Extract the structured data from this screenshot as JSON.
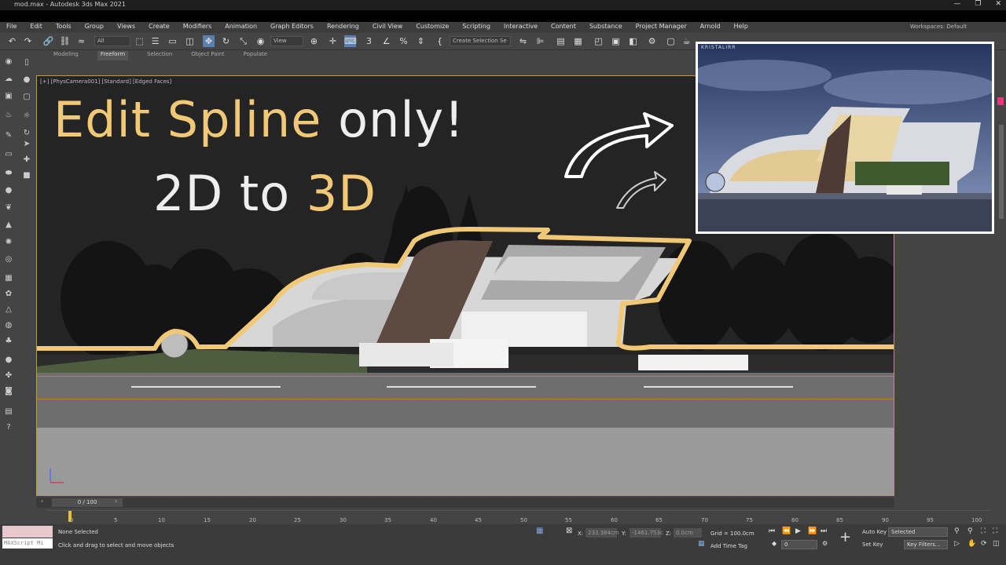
{
  "window": {
    "title": "mod.max - Autodesk 3ds Max 2021",
    "controls": [
      "—",
      "❐",
      "✕"
    ]
  },
  "menu": {
    "items": [
      "File",
      "Edit",
      "Tools",
      "Group",
      "Views",
      "Create",
      "Modifiers",
      "Animation",
      "Graph Editors",
      "Rendering",
      "Civil View",
      "Customize",
      "Scripting",
      "Interactive",
      "Content",
      "Substance",
      "Project Manager",
      "Arnold",
      "Help"
    ],
    "workspace_label": "Workspaces:",
    "workspace_value": "Default"
  },
  "toolbar": {
    "filter_value": "All",
    "view_value": "View",
    "selection_set_placeholder": "Create Selection Se"
  },
  "ribbon": {
    "tabs": [
      "Modeling",
      "Freeform",
      "Selection",
      "Object Paint",
      "Populate"
    ],
    "active": "Freeform"
  },
  "viewport": {
    "label": "[+] [PhysCamera001] [Standard] [Edged Faces]"
  },
  "overlay": {
    "line1_a": "Edit Spline",
    "line1_b": "only!",
    "line2_a": "2D to",
    "line2_b": "3D",
    "photo_watermark": "KRISTALIRR"
  },
  "timeline": {
    "frame": "0 / 100",
    "ticks": [
      "0",
      "5",
      "10",
      "15",
      "20",
      "25",
      "30",
      "35",
      "40",
      "45",
      "50",
      "55",
      "60",
      "65",
      "70",
      "75",
      "80",
      "85",
      "90",
      "95",
      "100"
    ]
  },
  "status": {
    "maxscript": "MAXScript Mi",
    "selection": "None Selected",
    "prompt": "Click and drag to select and move objects",
    "x_label": "X:",
    "x_value": "233.384cm",
    "y_label": "Y:",
    "y_value": "-1461.753c",
    "z_label": "Z:",
    "z_value": "0.0cm",
    "grid": "Grid = 100.0cm",
    "add_time_tag": "Add Time Tag",
    "frame_value": "0",
    "auto_key": "Auto Key",
    "set_key": "Set Key",
    "key_mode": "Selected",
    "key_filters": "Key Filters..."
  },
  "colors": {
    "accent_yellow": "#f1c976",
    "viewport_bg": "#242424",
    "ui_bg": "#444444"
  }
}
